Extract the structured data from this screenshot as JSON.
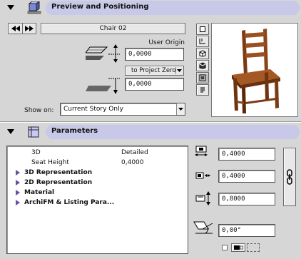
{
  "preview": {
    "title": "Preview and Positioning",
    "object_name": "Chair 02",
    "user_origin_label": "User Origin",
    "user_origin_value": "0,0000",
    "to_project_zero_label": "to Project Zero",
    "elevation_value": "0,0000",
    "show_on_label": "Show on:",
    "show_on_value": "Current Story Only",
    "view_buttons": [
      "floor-plan-icon",
      "section-icon",
      "3d-box-icon",
      "3d-solid-icon",
      "preview-image-icon",
      "list-icon"
    ]
  },
  "parameters": {
    "title": "Parameters",
    "rows": [
      {
        "label": "3D",
        "value": "Detailed"
      },
      {
        "label": "Seat Height",
        "value": "0,4000"
      }
    ],
    "groups": [
      "3D Representation",
      "2D Representation",
      "Material",
      "ArchiFM & Listing Para..."
    ],
    "dim_a": "0,4000",
    "dim_b": "0,4000",
    "dim_c": "0,8000",
    "angle": "0,00°"
  },
  "colors": {
    "header_pill": "#c8c8e8",
    "group_triangle": "#6b4fa0"
  }
}
